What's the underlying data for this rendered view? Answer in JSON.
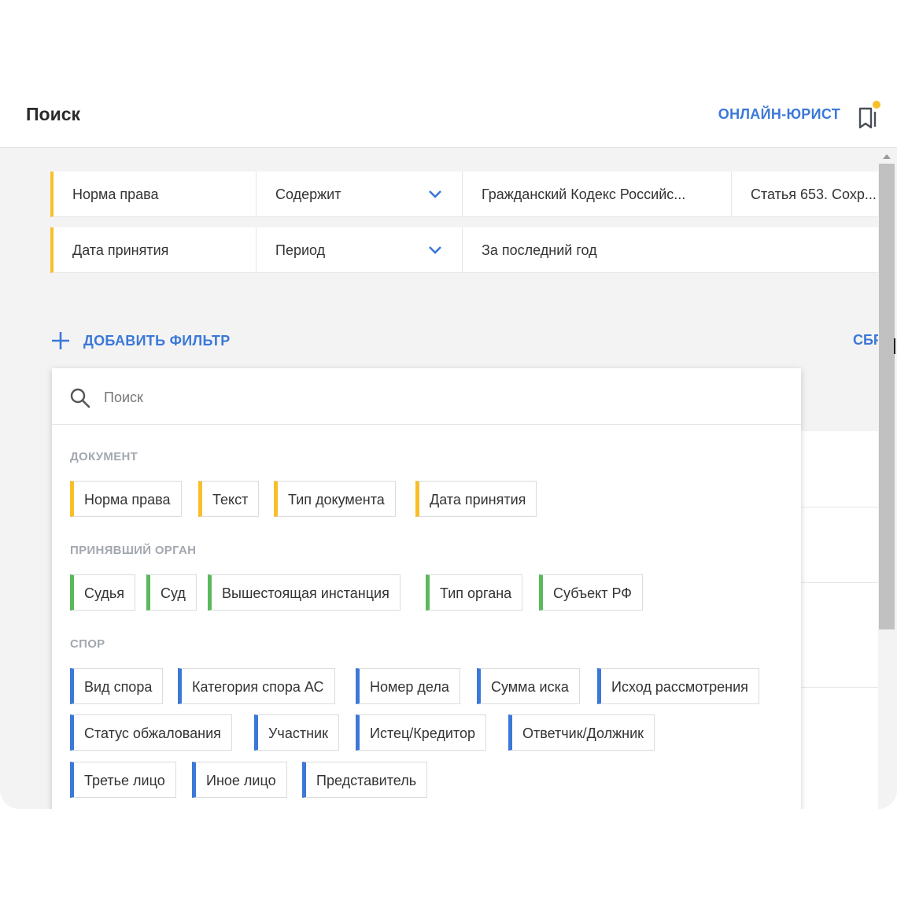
{
  "header": {
    "title": "Поиск",
    "online_link": "ОНЛАЙН-ЮРИСТ"
  },
  "filters": [
    {
      "field": "Норма права",
      "operator": "Содержит",
      "value": "Гражданский Кодекс Российс...",
      "extra": "Статья 653. Сохр..."
    },
    {
      "field": "Дата принятия",
      "operator": "Период",
      "value": "За последний год"
    }
  ],
  "actions": {
    "add_filter": "ДОБАВИТЬ ФИЛЬТР",
    "reset": "СБР"
  },
  "dropdown": {
    "search_placeholder": "Поиск",
    "sections": [
      {
        "title": "ДОКУМЕНТ",
        "items": [
          "Норма права",
          "Текст",
          "Тип документа",
          "Дата принятия"
        ]
      },
      {
        "title": "ПРИНЯВШИЙ ОРГАН",
        "items": [
          "Судья",
          "Суд",
          "Вышестоящая инстанция",
          "Тип органа",
          "Субъект РФ"
        ]
      },
      {
        "title": "СПОР",
        "items": [
          "Вид спора",
          "Категория спора АС",
          "Номер дела",
          "Сумма иска",
          "Исход рассмотрения",
          "Статус обжалования",
          "Участник",
          "Истец/Кредитор",
          "Ответчик/Должник",
          "Третье лицо",
          "Иное лицо",
          "Представитель"
        ]
      }
    ]
  },
  "colors": {
    "accent": "#3b78d8",
    "document": "#f8bf2b",
    "organ": "#5cb85c",
    "dispute": "#3b78d8",
    "notification_dot": "#f8bf2b"
  }
}
